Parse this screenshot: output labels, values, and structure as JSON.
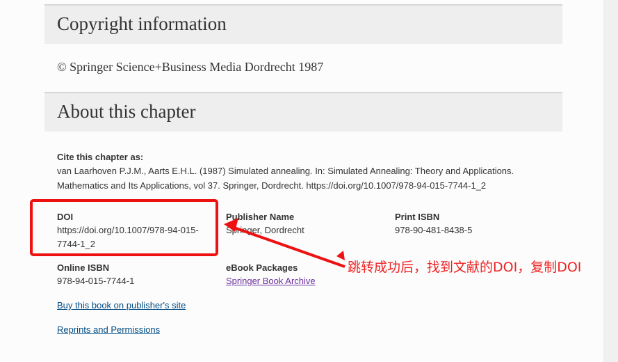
{
  "copyright": {
    "heading": "Copyright information",
    "text": "© Springer Science+Business Media Dordrecht 1987"
  },
  "chapter": {
    "heading": "About this chapter",
    "cite_label": "Cite this chapter as:",
    "cite_line1": "van Laarhoven P.J.M., Aarts E.H.L. (1987) Simulated annealing. In: Simulated Annealing: Theory and Applications.",
    "cite_line2": "Mathematics and Its Applications, vol 37. Springer, Dordrecht. https://doi.org/10.1007/978-94-015-7744-1_2",
    "doi_label": "DOI",
    "doi_line1": "https://doi.org/10.1007/978-94-015-",
    "doi_line2": "7744-1_2",
    "publisher_label": "Publisher Name",
    "publisher_value": "Springer, Dordrecht",
    "print_isbn_label": "Print ISBN",
    "print_isbn_value": "978-90-481-8438-5",
    "online_isbn_label": "Online ISBN",
    "online_isbn_value": "978-94-015-7744-1",
    "ebook_label": "eBook Packages",
    "ebook_value": "Springer Book Archive",
    "buy_link": "Buy this book on publisher's site",
    "reprints_link": "Reprints and Permissions"
  },
  "annotation": {
    "text": "跳转成功后，找到文献的DOI，复制DOI",
    "color": "#ee1111"
  },
  "colors": {
    "link": "#004b83",
    "visited_link": "#6b2fa0",
    "section_bg": "#eeeeee"
  }
}
